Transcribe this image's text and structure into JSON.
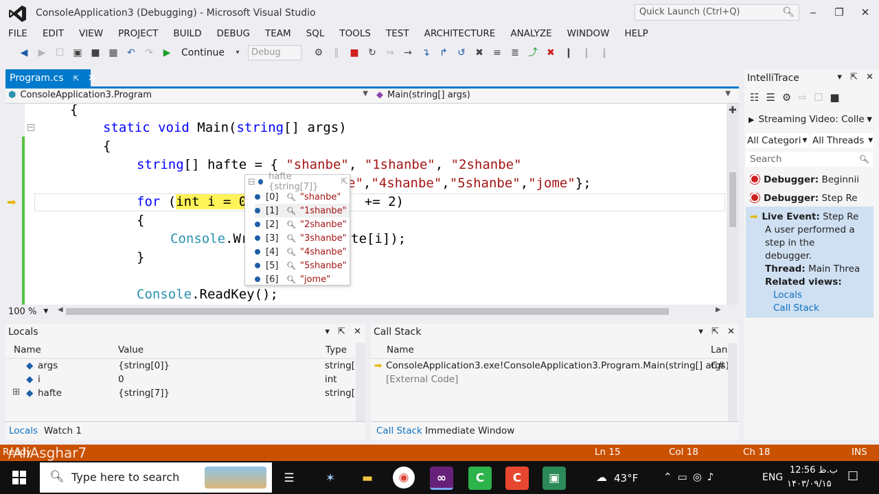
{
  "window": {
    "title": "ConsoleApplication3 (Debugging) - Microsoft Visual Studio",
    "quick_launch_placeholder": "Quick Launch (Ctrl+Q)"
  },
  "menu": [
    "FILE",
    "EDIT",
    "VIEW",
    "PROJECT",
    "BUILD",
    "DEBUG",
    "TEAM",
    "SQL",
    "TOOLS",
    "TEST",
    "ARCHITECTURE",
    "ANALYZE",
    "WINDOW",
    "HELP"
  ],
  "toolbar": {
    "continue_label": "Continue",
    "config_value": "Debug"
  },
  "document_tab": {
    "label": "Program.cs"
  },
  "navbar": {
    "left": "ConsoleApplication3.Program",
    "right": "Main(string[] args)"
  },
  "editor": {
    "lines": {
      "l1": "{",
      "l2_kw": "static void ",
      "l2_name": "Main(",
      "l2_kw2": "string",
      "l2_rest": "[] args)",
      "l3": "{",
      "l4_kw": "string",
      "l4_rest": "[] hafte = { ",
      "l4_s1": "\"shanbe\"",
      "l4_c1": ", ",
      "l4_s2": "\"1shanbe\"",
      "l4_c2": ", ",
      "l4_s3": "\"2shanbe\"",
      "l5_s1": "e\"",
      "l5_c1": ",",
      "l5_s2": "\"4shanbe\"",
      "l5_c2": ",",
      "l5_s3": "\"5shanbe\"",
      "l5_c3": ",",
      "l5_s4": "\"jome\"",
      "l5_end": "};",
      "l6_kw": "for",
      "l6_a": " (",
      "l6_hl": "int i = 0",
      "l6_gap": "               ",
      "l6_end": "+= 2)",
      "l7": "{",
      "l8_cls": "Console",
      "l8_a": ".Wr",
      "l8_gap": "             ",
      "l8_end": "te[i]);",
      "l9": "}",
      "l10_cls": "Console",
      "l10_rest": ".ReadKey();"
    },
    "zoom": "100 %"
  },
  "datatip": {
    "header": "hafte {string[7]}",
    "items": [
      {
        "index": "[0]",
        "value": "\"shanbe\""
      },
      {
        "index": "[1]",
        "value": "\"1shanbe\""
      },
      {
        "index": "[2]",
        "value": "\"2shanbe\""
      },
      {
        "index": "[3]",
        "value": "\"3shanbe\""
      },
      {
        "index": "[4]",
        "value": "\"4shanbe\""
      },
      {
        "index": "[5]",
        "value": "\"5shanbe\""
      },
      {
        "index": "[6]",
        "value": "\"jome\""
      }
    ]
  },
  "locals": {
    "title": "Locals",
    "columns": [
      "Name",
      "Value",
      "Type"
    ],
    "rows": [
      {
        "name": "args",
        "value": "{string[0]}",
        "type": "string[]"
      },
      {
        "name": "i",
        "value": "0",
        "type": "int"
      },
      {
        "name": "hafte",
        "value": "{string[7]}",
        "type": "string[]"
      }
    ],
    "tabs": [
      "Locals",
      "Watch 1"
    ]
  },
  "callstack": {
    "title": "Call Stack",
    "columns": [
      "Name",
      "Lan"
    ],
    "rows": [
      {
        "name": "ConsoleApplication3.exe!ConsoleApplication3.Program.Main(string[] args) l",
        "lang": "C#"
      },
      {
        "name": "[External Code]",
        "lang": ""
      }
    ],
    "tabs": [
      "Call Stack",
      "Immediate Window"
    ]
  },
  "intellitrace": {
    "title": "IntelliTrace",
    "session": "Streaming Video: Colle",
    "category_filter": "All Categori",
    "thread_filter": "All Threads",
    "search_placeholder": "Search",
    "events": [
      {
        "kind": "Debugger:",
        "text": "Beginnii"
      },
      {
        "kind": "Debugger:",
        "text": "Step Re"
      }
    ],
    "live": {
      "kind": "Live Event:",
      "text": "Step Re",
      "desc1": "A user performed a",
      "desc2": "step in the",
      "desc3": "debugger.",
      "thread_label": "Thread:",
      "thread_value": "Main Threa",
      "related_label": "Related views:",
      "link1": "Locals",
      "link2": "Call Stack"
    }
  },
  "status": {
    "left": "Ready",
    "watermark": "/AliAsghar7",
    "ln": "Ln 15",
    "col": "Col 18",
    "ch": "Ch 18",
    "mode": "INS"
  },
  "taskbar": {
    "search_placeholder": "Type here to search",
    "temperature": "43°F",
    "language": "ENG",
    "time": "12:56 ب.ظ",
    "date": "۱۴۰۳/۰۹/۱۵"
  },
  "colors": {
    "accent": "#007acc",
    "statusbar": "#ca5100",
    "keyword": "#0000ff",
    "string": "#a31515",
    "type": "#2b91af"
  }
}
